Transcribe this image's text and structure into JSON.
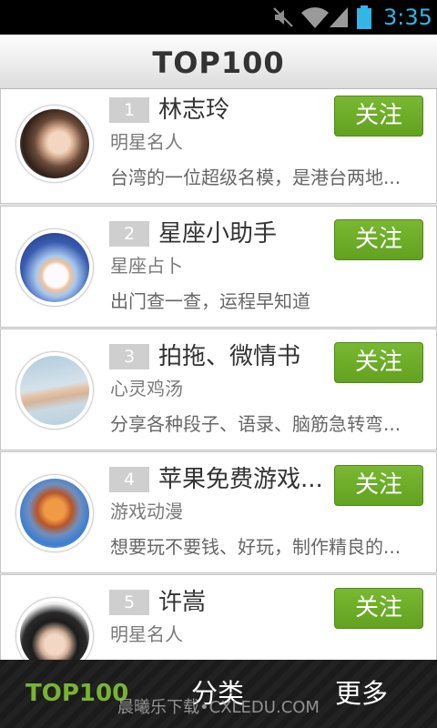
{
  "status_bar": {
    "time": "3:35",
    "icons": [
      "muted-speaker-icon",
      "wifi-icon",
      "signal-icon",
      "battery-icon"
    ]
  },
  "header": {
    "title": "TOP100"
  },
  "items": [
    {
      "rank": "1",
      "name": "林志玲",
      "category": "明星名人",
      "description": "台湾的一位超级名模，是港台两地...",
      "button": "关注"
    },
    {
      "rank": "2",
      "name": "星座小助手",
      "category": "星座占卜",
      "description": "出门查一查，运程早知道",
      "button": "关注"
    },
    {
      "rank": "3",
      "name": "拍拖、微情书",
      "category": "心灵鸡汤",
      "description": "分享各种段子、语录、脑筋急转弯...",
      "button": "关注"
    },
    {
      "rank": "4",
      "name": "苹果免费游戏...",
      "category": "游戏动漫",
      "description": "想要玩不要钱、好玩，制作精良的...",
      "button": "关注"
    },
    {
      "rank": "5",
      "name": "许嵩",
      "category": "明星名人",
      "button": "关注"
    }
  ],
  "bottom_nav": {
    "items": [
      {
        "label": "TOP100",
        "active": true
      },
      {
        "label": "分类",
        "active": false
      },
      {
        "label": "更多",
        "active": false
      }
    ]
  },
  "watermark": "晨曦乐下载•CXLEDU.COM",
  "colors": {
    "follow_button": "#6aab2a",
    "active_tab": "#79b430",
    "status_time": "#33b5e5",
    "rank_badge": "#cfcfcf"
  }
}
